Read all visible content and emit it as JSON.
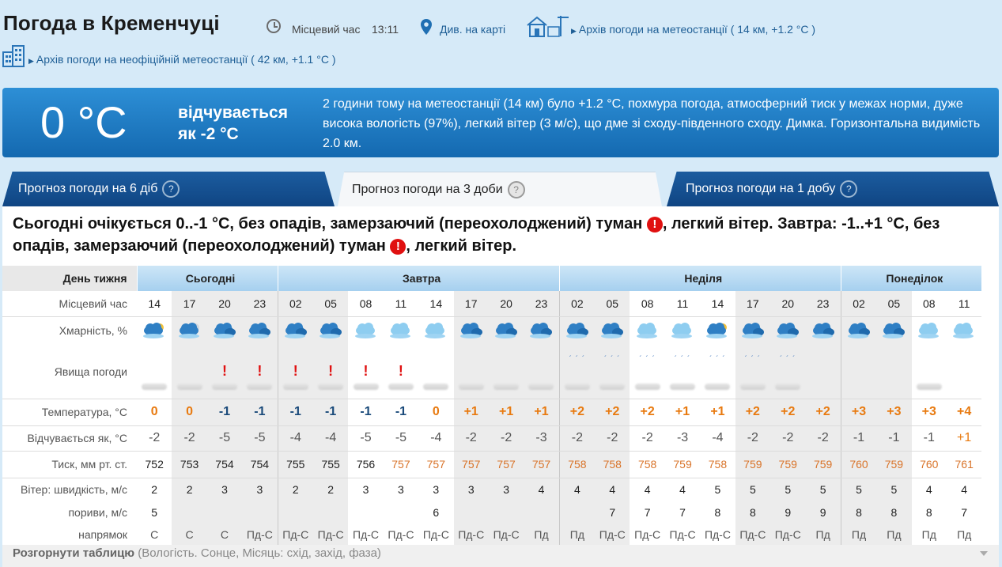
{
  "header": {
    "title": "Погода в Кременчуці",
    "local_time_label": "Місцевий час",
    "local_time": "13:11",
    "map_link": "Див. на карті",
    "archive_official": "Архів погоди на метеостанції",
    "archive_official_detail": "( 14 км, +1.2 °С )",
    "archive_unofficial": "Архів погоди на неофіційній метеостанції",
    "archive_unofficial_detail": "( 42 км, +1.1 °С )"
  },
  "current": {
    "temp": "0 °C",
    "feels_line1": "відчувається",
    "feels_line2": "як -2 °C",
    "description": "2 години тому на метеостанції (14 км) було +1.2 °С, похмура погода, атмосферний тиск у межах норми, дуже висока вологість (97%), легкий вітер (3 м/с), що дме зі сходу-південного сходу. Димка. Горизонтальна видимість 2.0 км."
  },
  "tabs": [
    {
      "label": "Прогноз погоди на 6 діб",
      "active": false
    },
    {
      "label": "Прогноз погоди на 3 доби",
      "active": true
    },
    {
      "label": "Прогноз погоди на 1 добу",
      "active": false
    }
  ],
  "summary": {
    "part1": "Сьогодні очікується 0..-1 °С, без опадів, замерзаючий (переохолоджений) туман ",
    "part2": ", легкий вітер. Завтра: -1..+1 °С, без опадів, замерзаючий (переохолоджений) туман ",
    "part3": ", легкий вітер.",
    "warn_symbol": "!"
  },
  "table": {
    "labels": {
      "day": "День тижня",
      "time": "Місцевий час",
      "cloud": "Хмарність, %",
      "phen": "Явища погоди",
      "temp": "Температура, °С",
      "feels": "Відчувається як, °С",
      "pres": "Тиск, мм рт. ст.",
      "wind": "Вітер: швидкість, м/с",
      "gust": "пориви, м/с",
      "dir": "напрямок"
    },
    "days": [
      {
        "name": "Сьогодні",
        "span": 4
      },
      {
        "name": "Завтра",
        "span": 8
      },
      {
        "name": "Неділя",
        "span": 8
      },
      {
        "name": "Понеділок",
        "span": 4
      }
    ],
    "times": [
      "14",
      "17",
      "20",
      "23",
      "02",
      "05",
      "08",
      "11",
      "14",
      "17",
      "20",
      "23",
      "02",
      "05",
      "08",
      "11",
      "14",
      "17",
      "20",
      "23",
      "02",
      "05",
      "08",
      "11"
    ],
    "temps": [
      "0",
      "0",
      "-1",
      "-1",
      "-1",
      "-1",
      "-1",
      "-1",
      "0",
      "+1",
      "+1",
      "+1",
      "+2",
      "+2",
      "+2",
      "+1",
      "+1",
      "+2",
      "+2",
      "+2",
      "+3",
      "+3",
      "+3",
      "+4"
    ],
    "feels": [
      "-2",
      "-2",
      "-5",
      "-5",
      "-4",
      "-4",
      "-5",
      "-5",
      "-4",
      "-2",
      "-2",
      "-3",
      "-2",
      "-2",
      "-2",
      "-3",
      "-4",
      "-2",
      "-2",
      "-2",
      "-1",
      "-1",
      "-1",
      "+1"
    ],
    "pressure": [
      "752",
      "753",
      "754",
      "754",
      "755",
      "755",
      "756",
      "757",
      "757",
      "757",
      "757",
      "757",
      "758",
      "758",
      "758",
      "759",
      "758",
      "759",
      "759",
      "759",
      "760",
      "759",
      "760",
      "761"
    ],
    "wind": [
      "2",
      "2",
      "3",
      "3",
      "2",
      "2",
      "3",
      "3",
      "3",
      "3",
      "3",
      "4",
      "4",
      "4",
      "4",
      "4",
      "5",
      "5",
      "5",
      "5",
      "5",
      "5",
      "4",
      "4"
    ],
    "gust": [
      "5",
      "",
      "",
      "",
      "",
      "",
      "",
      "",
      "6",
      "",
      "",
      "",
      "",
      "7",
      "7",
      "7",
      "8",
      "8",
      "9",
      "9",
      "8",
      "8",
      "8",
      "7"
    ],
    "direction": [
      "С",
      "С",
      "С",
      "Пд-С",
      "Пд-С",
      "Пд-С",
      "Пд-С",
      "Пд-С",
      "Пд-С",
      "Пд-С",
      "Пд-С",
      "Пд",
      "Пд",
      "Пд-С",
      "Пд-С",
      "Пд-С",
      "Пд-С",
      "Пд-С",
      "Пд-С",
      "Пд",
      "Пд",
      "Пд",
      "Пд",
      "Пд"
    ],
    "phenomena": [
      "fog",
      "fog",
      "fog-warn",
      "fog-warn",
      "fog-warn",
      "fog-warn",
      "fog-warn",
      "fog-warn",
      "fog",
      "fog",
      "fog",
      "fog",
      "fog-drizzle",
      "fog-drizzle",
      "fog-drizzle",
      "fog-drizzle",
      "fog-drizzle",
      "fog-drizzle",
      "fog-drizzle",
      "",
      "",
      "",
      "fog",
      ""
    ],
    "clouds": [
      "partly",
      "partly-night",
      "overcast",
      "overcast",
      "overcast",
      "overcast",
      "cloudy",
      "cloudy",
      "cloudy",
      "overcast",
      "overcast",
      "overcast",
      "overcast",
      "overcast",
      "cloudy",
      "cloudy",
      "partly",
      "overcast",
      "overcast",
      "overcast",
      "overcast",
      "overcast",
      "cloudy",
      "cloudy"
    ],
    "warn_symbol": "!",
    "rain_symbol": "´ ´ ´"
  },
  "expand": {
    "label": "Розгорнути таблицю",
    "detail": "(Вологість. Сонце, Місяць: схід, захід, фаза)"
  },
  "colors": {
    "accent": "#1469b0",
    "warm": "#e87a10",
    "cold": "#1a4a7a",
    "warn": "#e01010"
  }
}
